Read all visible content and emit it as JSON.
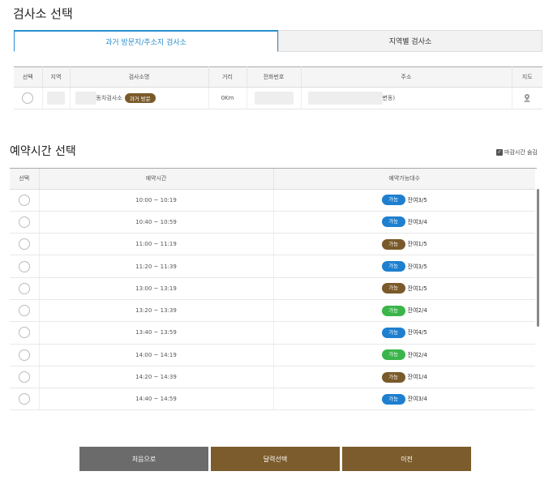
{
  "sections": {
    "center_select_title": "검사소 선택",
    "time_select_title": "예약시간 선택"
  },
  "tabs": [
    {
      "label": "과거 방문지/주소지 검사소",
      "active": true
    },
    {
      "label": "지역별 검사소",
      "active": false
    }
  ],
  "center_table": {
    "headers": [
      "선택",
      "지역",
      "검사소명",
      "거리",
      "전화번호",
      "주소",
      "지도"
    ],
    "rows": [
      {
        "name": "동차검사소",
        "badge": "과거 방문",
        "distance": "0Km",
        "address": "변동)"
      }
    ]
  },
  "closed_toggle": {
    "label": "마감시간 숨김",
    "checked": true
  },
  "time_table": {
    "headers": [
      "선택",
      "예약시간",
      "예약가능대수"
    ],
    "rows": [
      {
        "time": "10:00 ~ 10:19",
        "status": "가능",
        "color": "#1e7fcf",
        "remain": "잔여3/5"
      },
      {
        "time": "10:40 ~ 10:59",
        "status": "가능",
        "color": "#1e7fcf",
        "remain": "잔여3/4"
      },
      {
        "time": "11:00 ~ 11:19",
        "status": "가능",
        "color": "#7a5a2a",
        "remain": "잔여1/5"
      },
      {
        "time": "11:20 ~ 11:39",
        "status": "가능",
        "color": "#1e7fcf",
        "remain": "잔여3/5"
      },
      {
        "time": "13:00 ~ 13:19",
        "status": "가능",
        "color": "#7a5a2a",
        "remain": "잔여1/5"
      },
      {
        "time": "13:20 ~ 13:39",
        "status": "가능",
        "color": "#3bb54a",
        "remain": "잔여2/4"
      },
      {
        "time": "13:40 ~ 13:59",
        "status": "가능",
        "color": "#1e7fcf",
        "remain": "잔여4/5"
      },
      {
        "time": "14:00 ~ 14:19",
        "status": "가능",
        "color": "#3bb54a",
        "remain": "잔여2/4"
      },
      {
        "time": "14:20 ~ 14:39",
        "status": "가능",
        "color": "#7a5a2a",
        "remain": "잔여1/4"
      },
      {
        "time": "14:40 ~ 14:59",
        "status": "가능",
        "color": "#1e7fcf",
        "remain": "잔여3/4"
      }
    ]
  },
  "buttons": {
    "home": "처음으로",
    "calendar": "달력선택",
    "prev": "이전"
  }
}
